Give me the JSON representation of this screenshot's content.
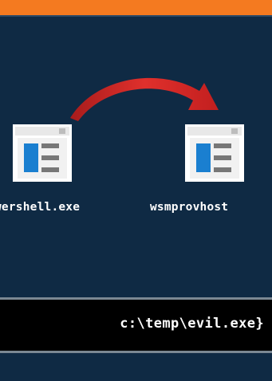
{
  "diagram": {
    "source_process": {
      "label": "wershell.exe",
      "icon": "window-icon"
    },
    "target_process": {
      "label": "wsmprovhost",
      "icon": "window-icon"
    },
    "arrow": {
      "icon": "curved-arrow-icon",
      "color": "#d42a2a"
    }
  },
  "terminal": {
    "command_text": "c:\\temp\\evil.exe}"
  },
  "colors": {
    "background": "#0f2a44",
    "accent_bar": "#f47a20",
    "icon_blue": "#1a7fd0",
    "terminal_bg": "#000000",
    "terminal_border": "#7b8893"
  }
}
